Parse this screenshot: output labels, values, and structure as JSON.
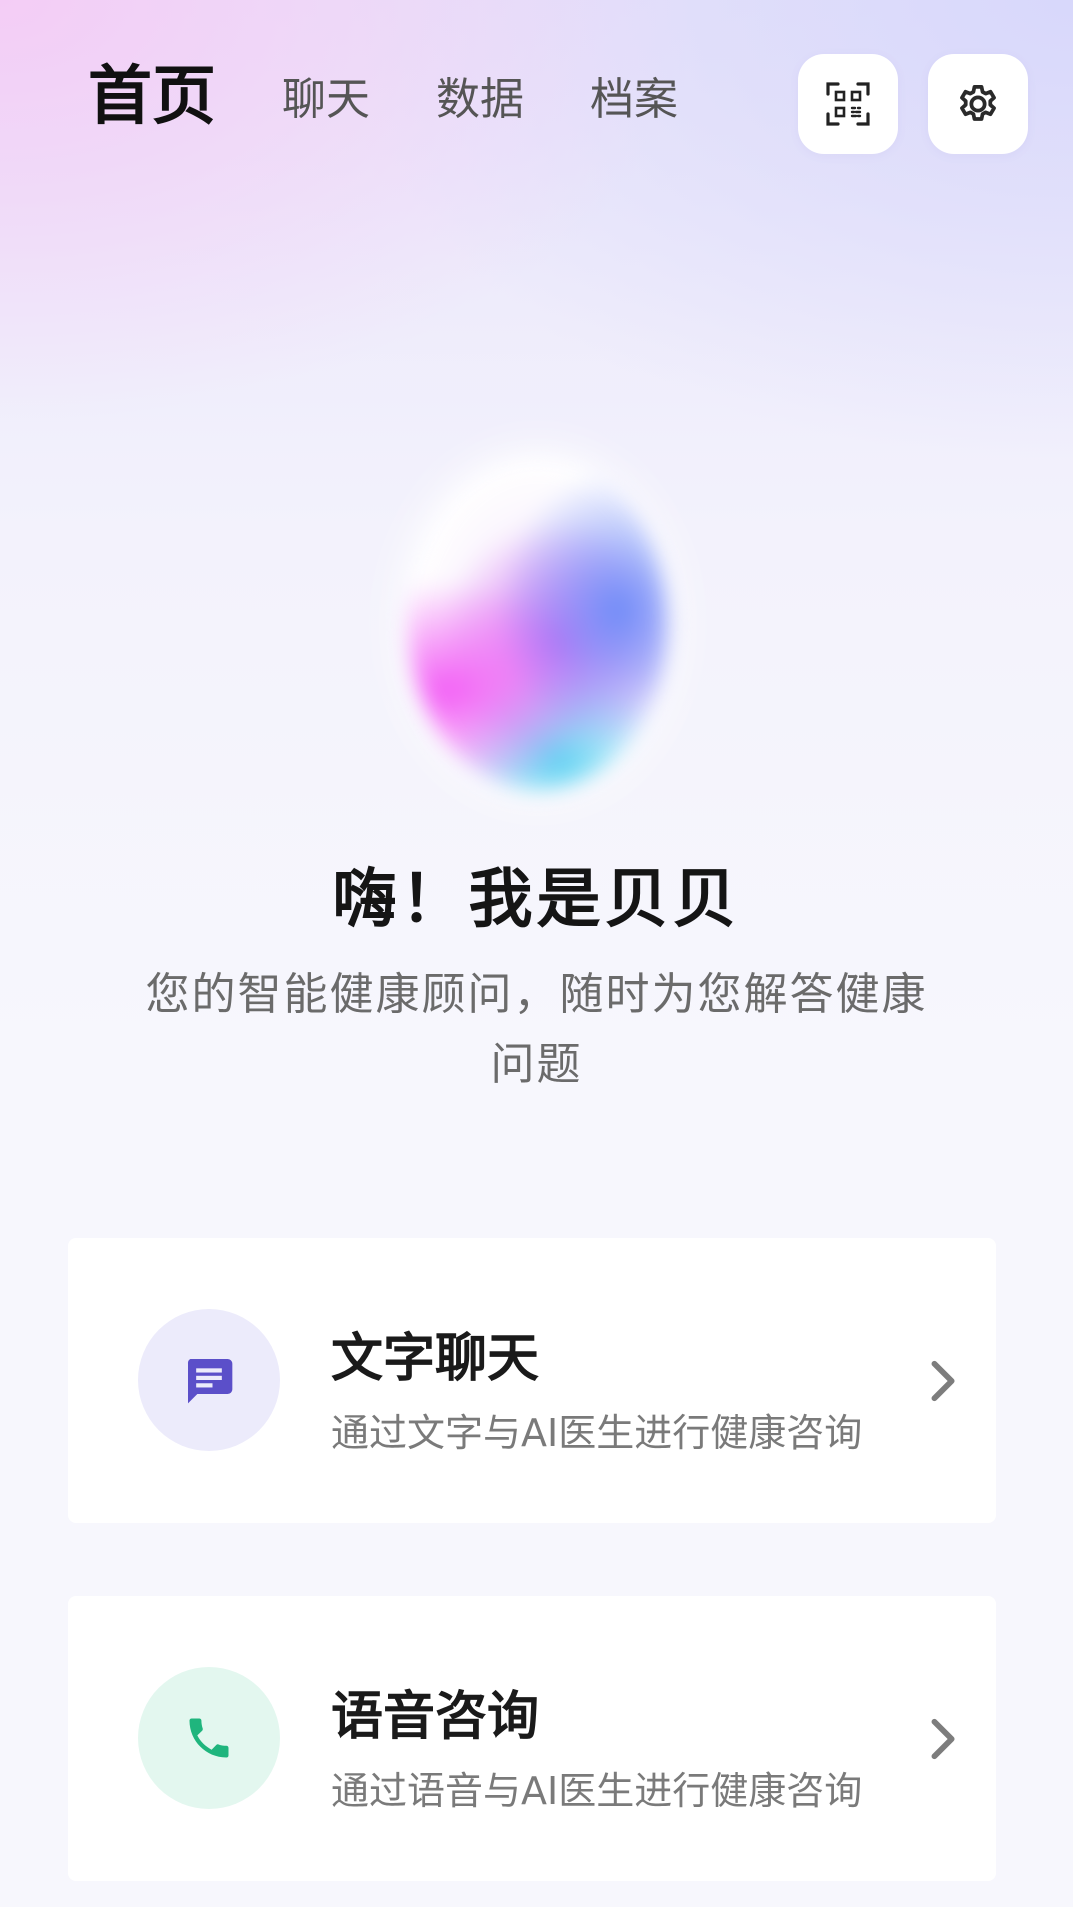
{
  "nav": {
    "tabs": [
      {
        "label": "首页",
        "active": true
      },
      {
        "label": "聊天",
        "active": false
      },
      {
        "label": "数据",
        "active": false
      },
      {
        "label": "档案",
        "active": false
      }
    ],
    "scan_icon": "qr-scan-icon",
    "settings_icon": "gear-icon"
  },
  "hero": {
    "greeting": "嗨！我是贝贝",
    "subtitle": "您的智能健康顾问，随时为您解答健康问题"
  },
  "cards": [
    {
      "title": "文字聊天",
      "description": "通过文字与AI医生进行健康咨询",
      "icon": "chat-message-icon",
      "icon_color": "#5b4fc9",
      "icon_bg": "#ecebfb"
    },
    {
      "title": "语音咨询",
      "description": "通过语音与AI医生进行健康咨询",
      "icon": "phone-icon",
      "icon_color": "#1fb57d",
      "icon_bg": "#e3f7ef"
    }
  ],
  "colors": {
    "primary_text": "#111111",
    "secondary_text": "#6b6b6b",
    "chat_accent": "#5b4fc9",
    "voice_accent": "#1fb57d"
  }
}
